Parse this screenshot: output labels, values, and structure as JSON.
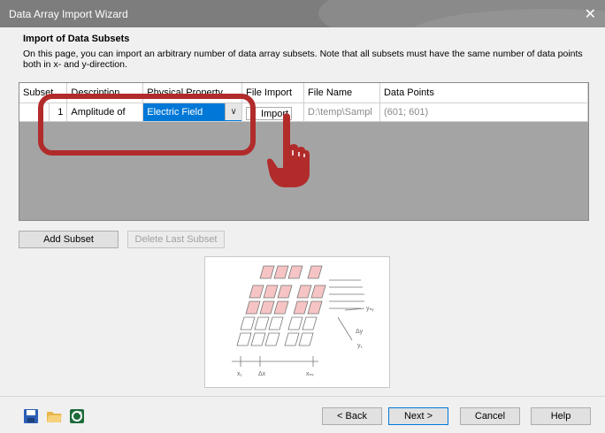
{
  "window": {
    "title": "Data Array Import Wizard",
    "close_glyph": "✕"
  },
  "page": {
    "heading": "Import of Data Subsets",
    "description": "On this page, you can import an arbitrary number of data array subsets. Note that all subsets must have the same number of data points both in x- and y-direction."
  },
  "table": {
    "columns": [
      "Subset",
      "Description",
      "Physical Property",
      "File Import",
      "File Name",
      "Data Points"
    ],
    "rows": [
      {
        "subset": "1",
        "description": "Amplitude of",
        "physical_property": "Electric Field",
        "file_import": "Import",
        "file_name": "D:\\temp\\Sampl",
        "data_points": "(601; 601)"
      }
    ]
  },
  "buttons": {
    "add_subset": "Add Subset",
    "delete_last_subset": "Delete Last Subset",
    "back": "< Back",
    "next": "Next >",
    "cancel": "Cancel",
    "help": "Help"
  },
  "illustration": {
    "label_x1": "x₁",
    "label_dx": "Δx",
    "label_xn": "xₙₓ",
    "label_yn": "yₙᵧ",
    "label_dy": "Δy",
    "label_y1": "y₁"
  },
  "icons": [
    "save-icon",
    "open-folder-icon",
    "refresh-icon",
    "pointing-hand-icon"
  ],
  "colors": {
    "highlight": "#b22b2b",
    "selection": "#0078d7",
    "grid_background": "#a4a4a4",
    "title_bar": "#7d7d7d"
  }
}
